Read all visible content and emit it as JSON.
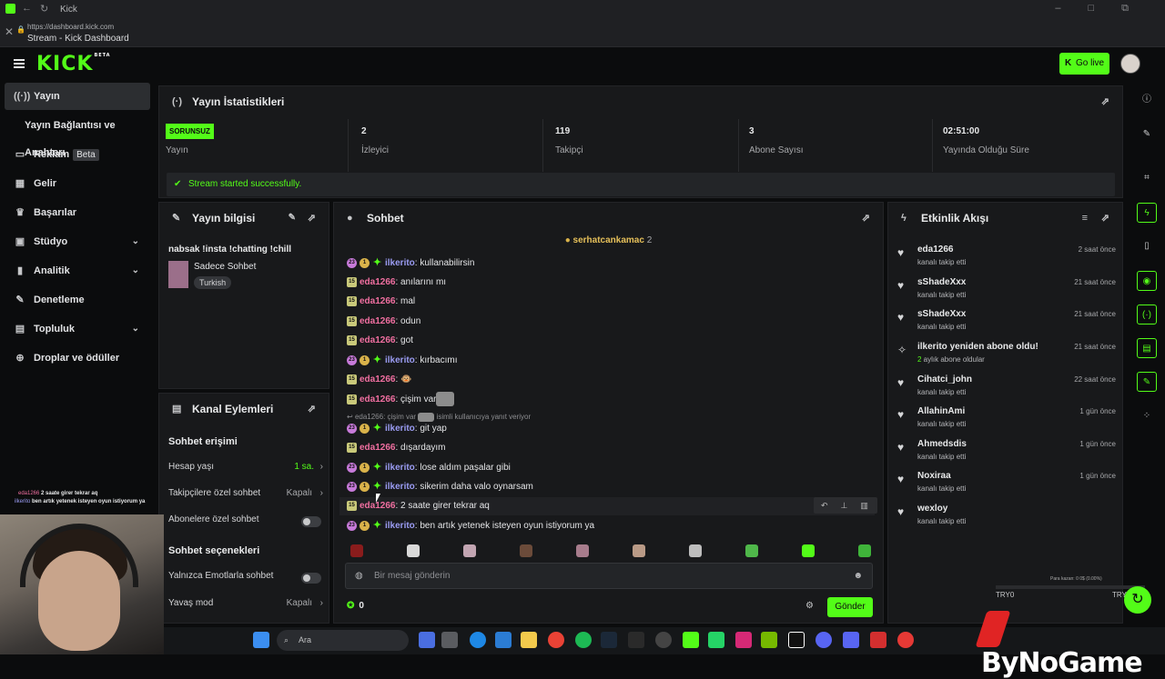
{
  "browser": {
    "window_title": "Kick",
    "url": "https://dashboard.kick.com",
    "page_title": "Stream - Kick Dashboard"
  },
  "header": {
    "logo": "KICK",
    "logo_badge": "BETA",
    "go_live_label": "Go live"
  },
  "sidebar": {
    "items": [
      {
        "label": "Yayın",
        "icon": "broadcast-icon"
      },
      {
        "label": "Yayın Bağlantısı ve Anahtarı",
        "icon": ""
      },
      {
        "label": "Reklam",
        "badge": "Beta",
        "icon": "ad-icon"
      },
      {
        "label": "Gelir",
        "icon": "revenue-icon"
      },
      {
        "label": "Başarılar",
        "icon": "trophy-icon"
      },
      {
        "label": "Stüdyo",
        "icon": "studio-icon"
      },
      {
        "label": "Analitik",
        "icon": "chart-icon"
      },
      {
        "label": "Denetleme",
        "icon": "wrench-icon"
      },
      {
        "label": "Topluluk",
        "icon": "community-icon"
      },
      {
        "label": "Droplar ve ödüller",
        "icon": "gift-icon"
      }
    ]
  },
  "stats": {
    "title": "Yayın İstatistikleri",
    "status_badge": "SORUNSUZ",
    "status_label": "Yayın",
    "items": [
      {
        "value": "2",
        "label": "İzleyici"
      },
      {
        "value": "119",
        "label": "Takipçi"
      },
      {
        "value": "3",
        "label": "Abone Sayısı"
      },
      {
        "value": "02:51:00",
        "label": "Yayında Olduğu Süre"
      }
    ],
    "success_message": "Stream started successfully."
  },
  "stream_info": {
    "title": "Yayın bilgisi",
    "stream_title": "nabsak !insta !chatting !chill",
    "category": "Sadece Sohbet",
    "tag": "Turkish"
  },
  "channel_actions": {
    "title": "Kanal Eylemleri",
    "section1": "Sohbet erişimi",
    "account_age_label": "Hesap yaşı",
    "account_age_value": "1 sa.",
    "followers_only_label": "Takipçilere özel sohbet",
    "followers_only_value": "Kapalı",
    "subs_only_label": "Abonelere özel sohbet",
    "section2": "Sohbet seçenekleri",
    "emote_only_label": "Yalnızca Emotlarla sohbet",
    "slow_mode_label": "Yavaş mod",
    "slow_mode_value": "Kapalı"
  },
  "chat": {
    "title": "Sohbet",
    "pinned_user": "serhatcankamac",
    "pinned_count": "2",
    "messages": [
      {
        "user": "ilkerito",
        "text": ": kullanabilirsin"
      },
      {
        "user": "eda1266",
        "text": ": anılarını mı"
      },
      {
        "user": "eda1266",
        "text": ": mal"
      },
      {
        "user": "eda1266",
        "text": ": odun"
      },
      {
        "user": "eda1266",
        "text": ": got"
      },
      {
        "user": "ilkerito",
        "text": ": kırbacımı"
      },
      {
        "user": "eda1266",
        "text": ":"
      },
      {
        "user": "eda1266",
        "text": ": çişim var"
      },
      {
        "user": "ilkerito",
        "text": ": git yap"
      },
      {
        "user": "eda1266",
        "text": ": dışardayım"
      },
      {
        "user": "ilkerito",
        "text": ": lose aldım paşalar gibi"
      },
      {
        "user": "ilkerito",
        "text": ": sikerim daha valo oynarsam"
      },
      {
        "user": "eda1266",
        "text": ": 2 saate girer tekrar aq"
      },
      {
        "user": "ilkerito",
        "text": ": ben artık yetenek isteyen oyun istiyorum ya"
      }
    ],
    "reply_context": "eda1266: çişim var",
    "reply_note": "isimli kullanıcıya yanıt veriyor",
    "input_placeholder": "Bir mesaj gönderin",
    "points": "0",
    "send_label": "Gönder"
  },
  "activity": {
    "title": "Etkinlik Akışı",
    "items": [
      {
        "user": "eda1266",
        "sub": "kanalı takip etti",
        "time": "2 saat önce",
        "icon": "heart-icon"
      },
      {
        "user": "sShadeXxx",
        "sub": "kanalı takip etti",
        "time": "21 saat önce",
        "icon": "heart-icon"
      },
      {
        "user": "sShadeXxx",
        "sub": "kanalı takip etti",
        "time": "21 saat önce",
        "icon": "heart-icon"
      },
      {
        "user": "ilkerito yeniden abone oldu!",
        "sub_green": "2",
        "sub": " aylık abone oldular",
        "time": "21 saat önce",
        "icon": "sparkle-icon"
      },
      {
        "user": "Cihatci_john",
        "sub": "kanalı takip etti",
        "time": "22 saat önce",
        "icon": "heart-icon"
      },
      {
        "user": "AllahinAmi",
        "sub": "kanalı takip etti",
        "time": "1 gün önce",
        "icon": "heart-icon"
      },
      {
        "user": "Ahmedsdis",
        "sub": "kanalı takip etti",
        "time": "1 gün önce",
        "icon": "heart-icon"
      },
      {
        "user": "Noxiraa",
        "sub": "kanalı takip etti",
        "time": "1 gün önce",
        "icon": "heart-icon"
      },
      {
        "user": "wexloy",
        "sub": "kanalı takip etti",
        "time": "1 gün önce",
        "icon": "heart-icon"
      }
    ]
  },
  "overlay_chat": [
    {
      "user": "eda1266",
      "text": "2 saate girer tekrar aq"
    },
    {
      "user": "ilkerito",
      "text": "ben artık yetenek isteyen oyun istiyorum ya"
    }
  ],
  "taskbar": {
    "search_placeholder": "Ara"
  },
  "watermark": {
    "brand": "ByNoGame"
  },
  "game_overlay": {
    "left": "TRY0",
    "right": "TRY0",
    "mini": "Para kazan: 0\n0$ (0.00%)"
  },
  "colors": {
    "accent": "#53fc18",
    "panel": "#18191b",
    "background": "#0b0c0d"
  }
}
